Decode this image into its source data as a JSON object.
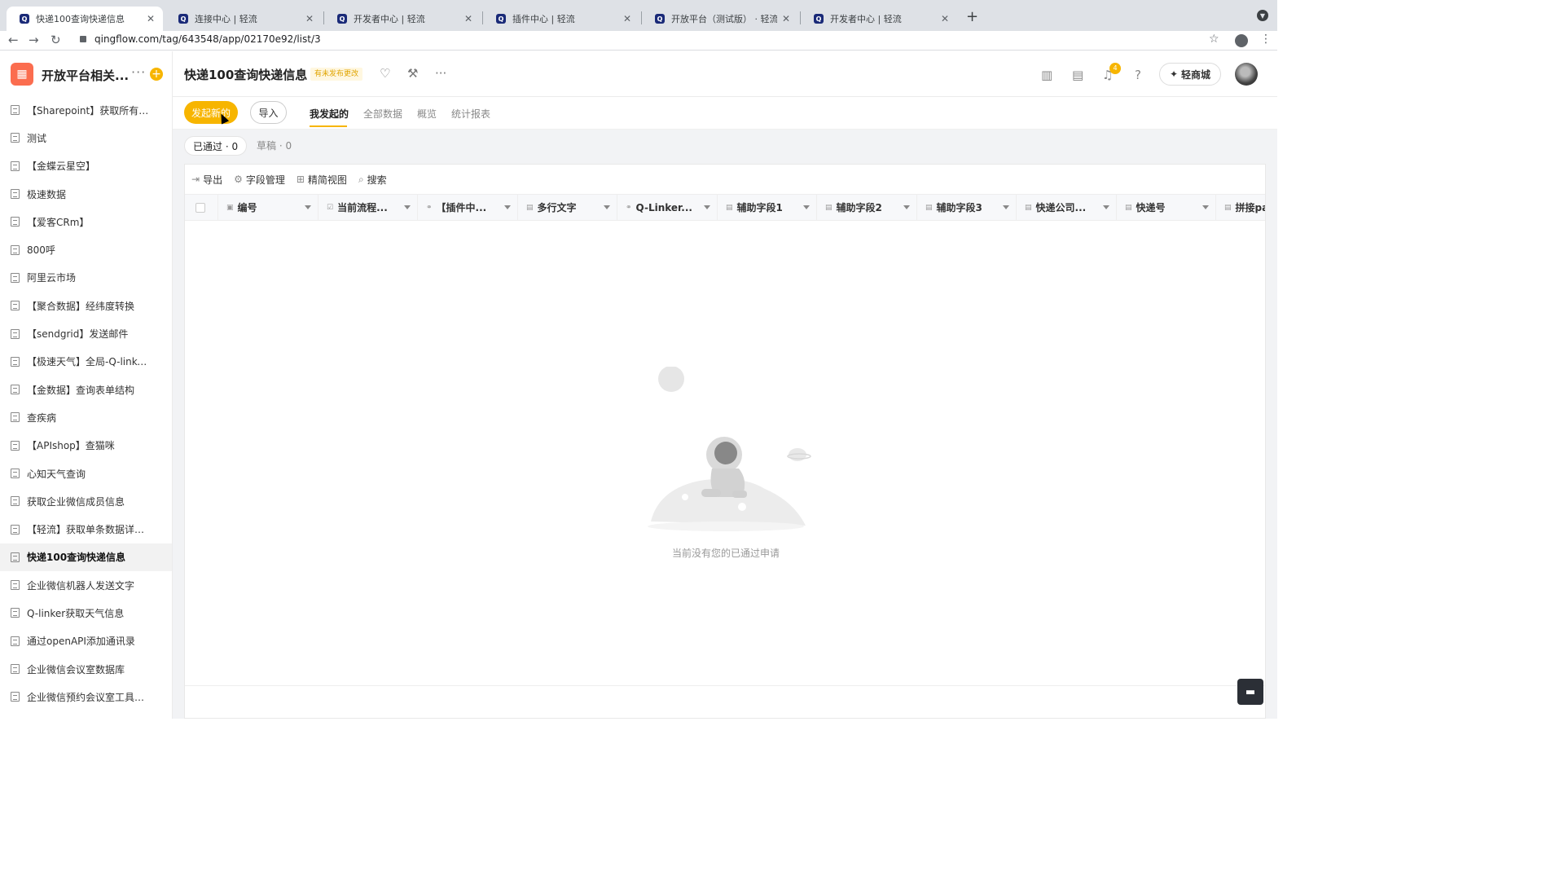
{
  "browser": {
    "tabs": [
      {
        "title": "快递100查询快递信息",
        "active": true
      },
      {
        "title": "连接中心 | 轻流",
        "active": false
      },
      {
        "title": "开发者中心 | 轻流",
        "active": false
      },
      {
        "title": "插件中心 | 轻流",
        "active": false
      },
      {
        "title": "开放平台（测试版） · 轻流",
        "active": false
      },
      {
        "title": "开发者中心 | 轻流",
        "active": false
      }
    ],
    "url": "qingflow.com/tag/643548/app/02170e92/list/3"
  },
  "sidebar": {
    "app_name": "开放平台相关...",
    "items": [
      {
        "label": "【Sharepoint】获取所有列..."
      },
      {
        "label": "测试"
      },
      {
        "label": "【金蝶云星空】"
      },
      {
        "label": "极速数据"
      },
      {
        "label": "【爱客CRm】"
      },
      {
        "label": "800呼"
      },
      {
        "label": "阿里云市场"
      },
      {
        "label": "【聚合数据】经纬度转换"
      },
      {
        "label": "【sendgrid】发送邮件"
      },
      {
        "label": "【极速天气】全局-Q-linker..."
      },
      {
        "label": "【金数据】查询表单结构"
      },
      {
        "label": "查疾病"
      },
      {
        "label": "【APIshop】查猫咪"
      },
      {
        "label": "心知天气查询"
      },
      {
        "label": "获取企业微信成员信息"
      },
      {
        "label": "【轻流】获取单条数据详细..."
      },
      {
        "label": "快递100查询快递信息",
        "active": true
      },
      {
        "label": "企业微信机器人发送文字"
      },
      {
        "label": "Q-linker获取天气信息"
      },
      {
        "label": "通过openAPI添加通讯录"
      },
      {
        "label": "企业微信会议室数据库"
      },
      {
        "label": "企业微信预约会议室工具de..."
      }
    ]
  },
  "header": {
    "title": "快递100查询快递信息",
    "unpublished_badge": "有未发布更改",
    "notification_count": "4",
    "mall_label": "轻商城"
  },
  "toolbar": {
    "new_label": "发起新的",
    "import_label": "导入",
    "view_tabs": [
      {
        "label": "我发起的",
        "active": true
      },
      {
        "label": "全部数据"
      },
      {
        "label": "概览"
      },
      {
        "label": "统计报表"
      }
    ]
  },
  "filters": [
    {
      "label": "已通过 · 0",
      "active": true
    },
    {
      "label": "草稿 · 0"
    }
  ],
  "actions": {
    "export": "导出",
    "fields": "字段管理",
    "compact_view": "精简视图",
    "search": "搜索"
  },
  "table": {
    "columns": [
      {
        "label": "编号",
        "icon": "number-field-icon"
      },
      {
        "label": "当前流程...",
        "icon": "checkbox-field-icon"
      },
      {
        "label": "【插件中...",
        "icon": "link-field-icon"
      },
      {
        "label": "多行文字",
        "icon": "text-field-icon"
      },
      {
        "label": "Q-Linker...",
        "icon": "link-field-icon"
      },
      {
        "label": "辅助字段1",
        "icon": "text-field-icon"
      },
      {
        "label": "辅助字段2",
        "icon": "text-field-icon"
      },
      {
        "label": "辅助字段3",
        "icon": "text-field-icon"
      },
      {
        "label": "快递公司...",
        "icon": "text-field-icon"
      },
      {
        "label": "快递号",
        "icon": "text-field-icon"
      },
      {
        "label": "拼接par",
        "icon": "text-field-icon"
      }
    ],
    "rows": [],
    "empty_text": "当前没有您的已通过申请"
  },
  "colors": {
    "accent": "#f7b500",
    "app_logo": "#fb6d4f"
  }
}
